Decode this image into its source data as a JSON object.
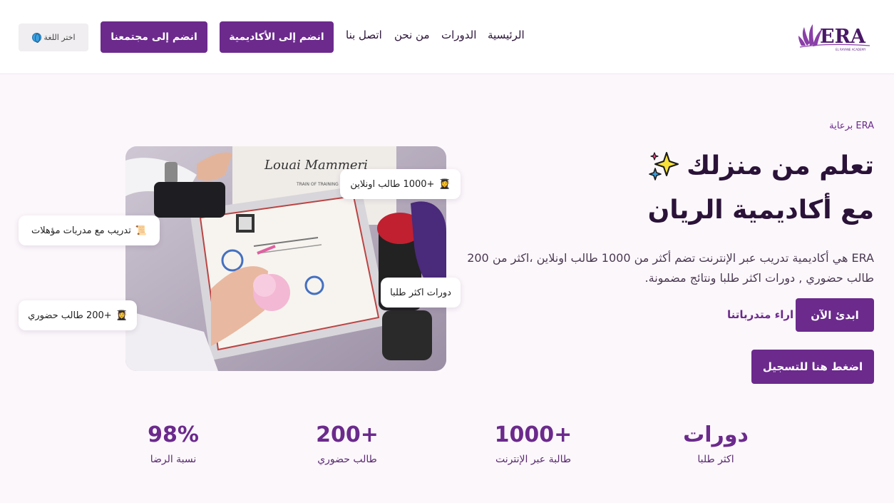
{
  "header": {
    "logo_text": "ERA",
    "logo_subtext": "EL RAYANE ACADEMY",
    "nav": {
      "home": "الرئيسية",
      "courses": "الدورات",
      "about": "من نحن",
      "contact": "اتصل بنا"
    },
    "join_academy": "انضم إلى الأكاديمية",
    "join_community": "انضم إلى مجتمعنا",
    "language": "اختر اللغة"
  },
  "hero": {
    "sponsor": "برعاية ERA",
    "title_line1": "تعلم من منزلك",
    "title_line2": "مع أكاديمية الريان",
    "description": "ERA هي أكاديمية تدريب عبر الإنترنت تضم أكثر من 1000 طالب اونلاين ،اكثر من 200 طالب حضوري , دورات اكثر طلبا ونتائج مضمونة.",
    "start_button": "ابدئ الآن",
    "reviews_link": "اراء متدرباتنا",
    "register_button": "اضغط هنا للتسجيل"
  },
  "chips": {
    "online": "+1000 طالب اونلاين",
    "trainers": "تدريب مع مدربات مؤهلات",
    "courses": "دورات اكثر طلبا",
    "inperson": "+200 طالب حضوري"
  },
  "photo_text": {
    "cert_name": "Louai Mammeri",
    "cert_subtitle": "TRAIN OF TRAINING"
  },
  "stats": [
    {
      "value": "دورات",
      "label": "اكثر طلبا"
    },
    {
      "value": "1000+",
      "label": "طالبة عبر الإنترنت"
    },
    {
      "value": "200+",
      "label": "طالب حضوري"
    },
    {
      "value": "98%",
      "label": "نسبة الرضا"
    }
  ],
  "colors": {
    "brand": "#6b2a8c",
    "title": "#2a1238",
    "background": "#fcf7fb"
  },
  "icons": {
    "sparkle": "sparkles-icon",
    "globe": "globe-icon",
    "student": "student-icon",
    "scroll": "scroll-icon"
  }
}
